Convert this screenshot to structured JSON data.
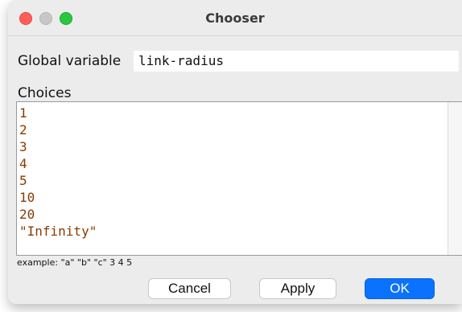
{
  "window": {
    "title": "Chooser"
  },
  "global_variable": {
    "label": "Global variable",
    "value": "link-radius"
  },
  "choices": {
    "label": "Choices",
    "items": [
      "1",
      "2",
      "3",
      "4",
      "5",
      "10",
      "20",
      "\"Infinity\""
    ]
  },
  "example_text": "example: \"a\" \"b\" \"c\" 3 4 5",
  "buttons": {
    "cancel": "Cancel",
    "apply": "Apply",
    "ok": "OK"
  },
  "colors": {
    "close": "#ff5f57",
    "minimize": "#c7c7c7",
    "maximize": "#28c840",
    "choice_text": "#8a3a00",
    "ok_button": "#0a72ff"
  }
}
